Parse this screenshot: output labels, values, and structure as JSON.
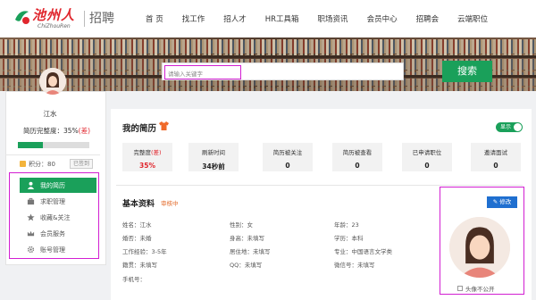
{
  "header": {
    "logo_cn": "池州人",
    "logo_en": "ChiZhouRen",
    "logo_job": "招聘",
    "nav": [
      "首 页",
      "找工作",
      "招人才",
      "HR工具箱",
      "职场资讯",
      "会员中心",
      "招聘会",
      "云端职位"
    ]
  },
  "search": {
    "placeholder": "请输入关键字",
    "button": "搜索"
  },
  "sidebar": {
    "username": "江水",
    "completeness_label": "简历完整度：35%",
    "completeness_tag": "(差)",
    "completeness_value": 0.35,
    "points": "积分：80",
    "signed": "已签到",
    "menu": [
      {
        "label": "我的简历",
        "icon": "user-icon"
      },
      {
        "label": "求职管理",
        "icon": "briefcase-icon"
      },
      {
        "label": "收藏&关注",
        "icon": "star-icon"
      },
      {
        "label": "会员服务",
        "icon": "crown-icon"
      },
      {
        "label": "账号管理",
        "icon": "gear-icon"
      }
    ]
  },
  "resume": {
    "title": "我的简历",
    "toggle": "显示",
    "stats": [
      {
        "label": "完整度",
        "tag": "(差)",
        "value": "35%"
      },
      {
        "label": "刷新时间",
        "value": "34秒前"
      },
      {
        "label": "简历被关注",
        "value": "0"
      },
      {
        "label": "简历被查看",
        "value": "0"
      },
      {
        "label": "已申请职位",
        "value": "0"
      },
      {
        "label": "邀请面试",
        "value": "0"
      }
    ]
  },
  "basic": {
    "title": "基本资料",
    "status": "审核中",
    "edit": "修改",
    "hide_avatar": "头像不公开",
    "fields": {
      "name": "姓名：江水",
      "gender": "性别：女",
      "age": "年龄：23",
      "marriage": "婚否：未婚",
      "height": "身高：未填写",
      "education": "学历：本科",
      "experience": "工作经验：3-5年",
      "residence": "居住地：未填写",
      "major": "专业：中国语言文学类",
      "hometown": "籍贯：未填写",
      "qq": "QQ：未填写",
      "wechat": "微信号：未填写",
      "phone": "手机号："
    }
  },
  "colors": {
    "brand_red": "#e0262d",
    "green": "#1aa05a",
    "blue": "#1f6fd0",
    "highlight": "#d21fd2"
  }
}
